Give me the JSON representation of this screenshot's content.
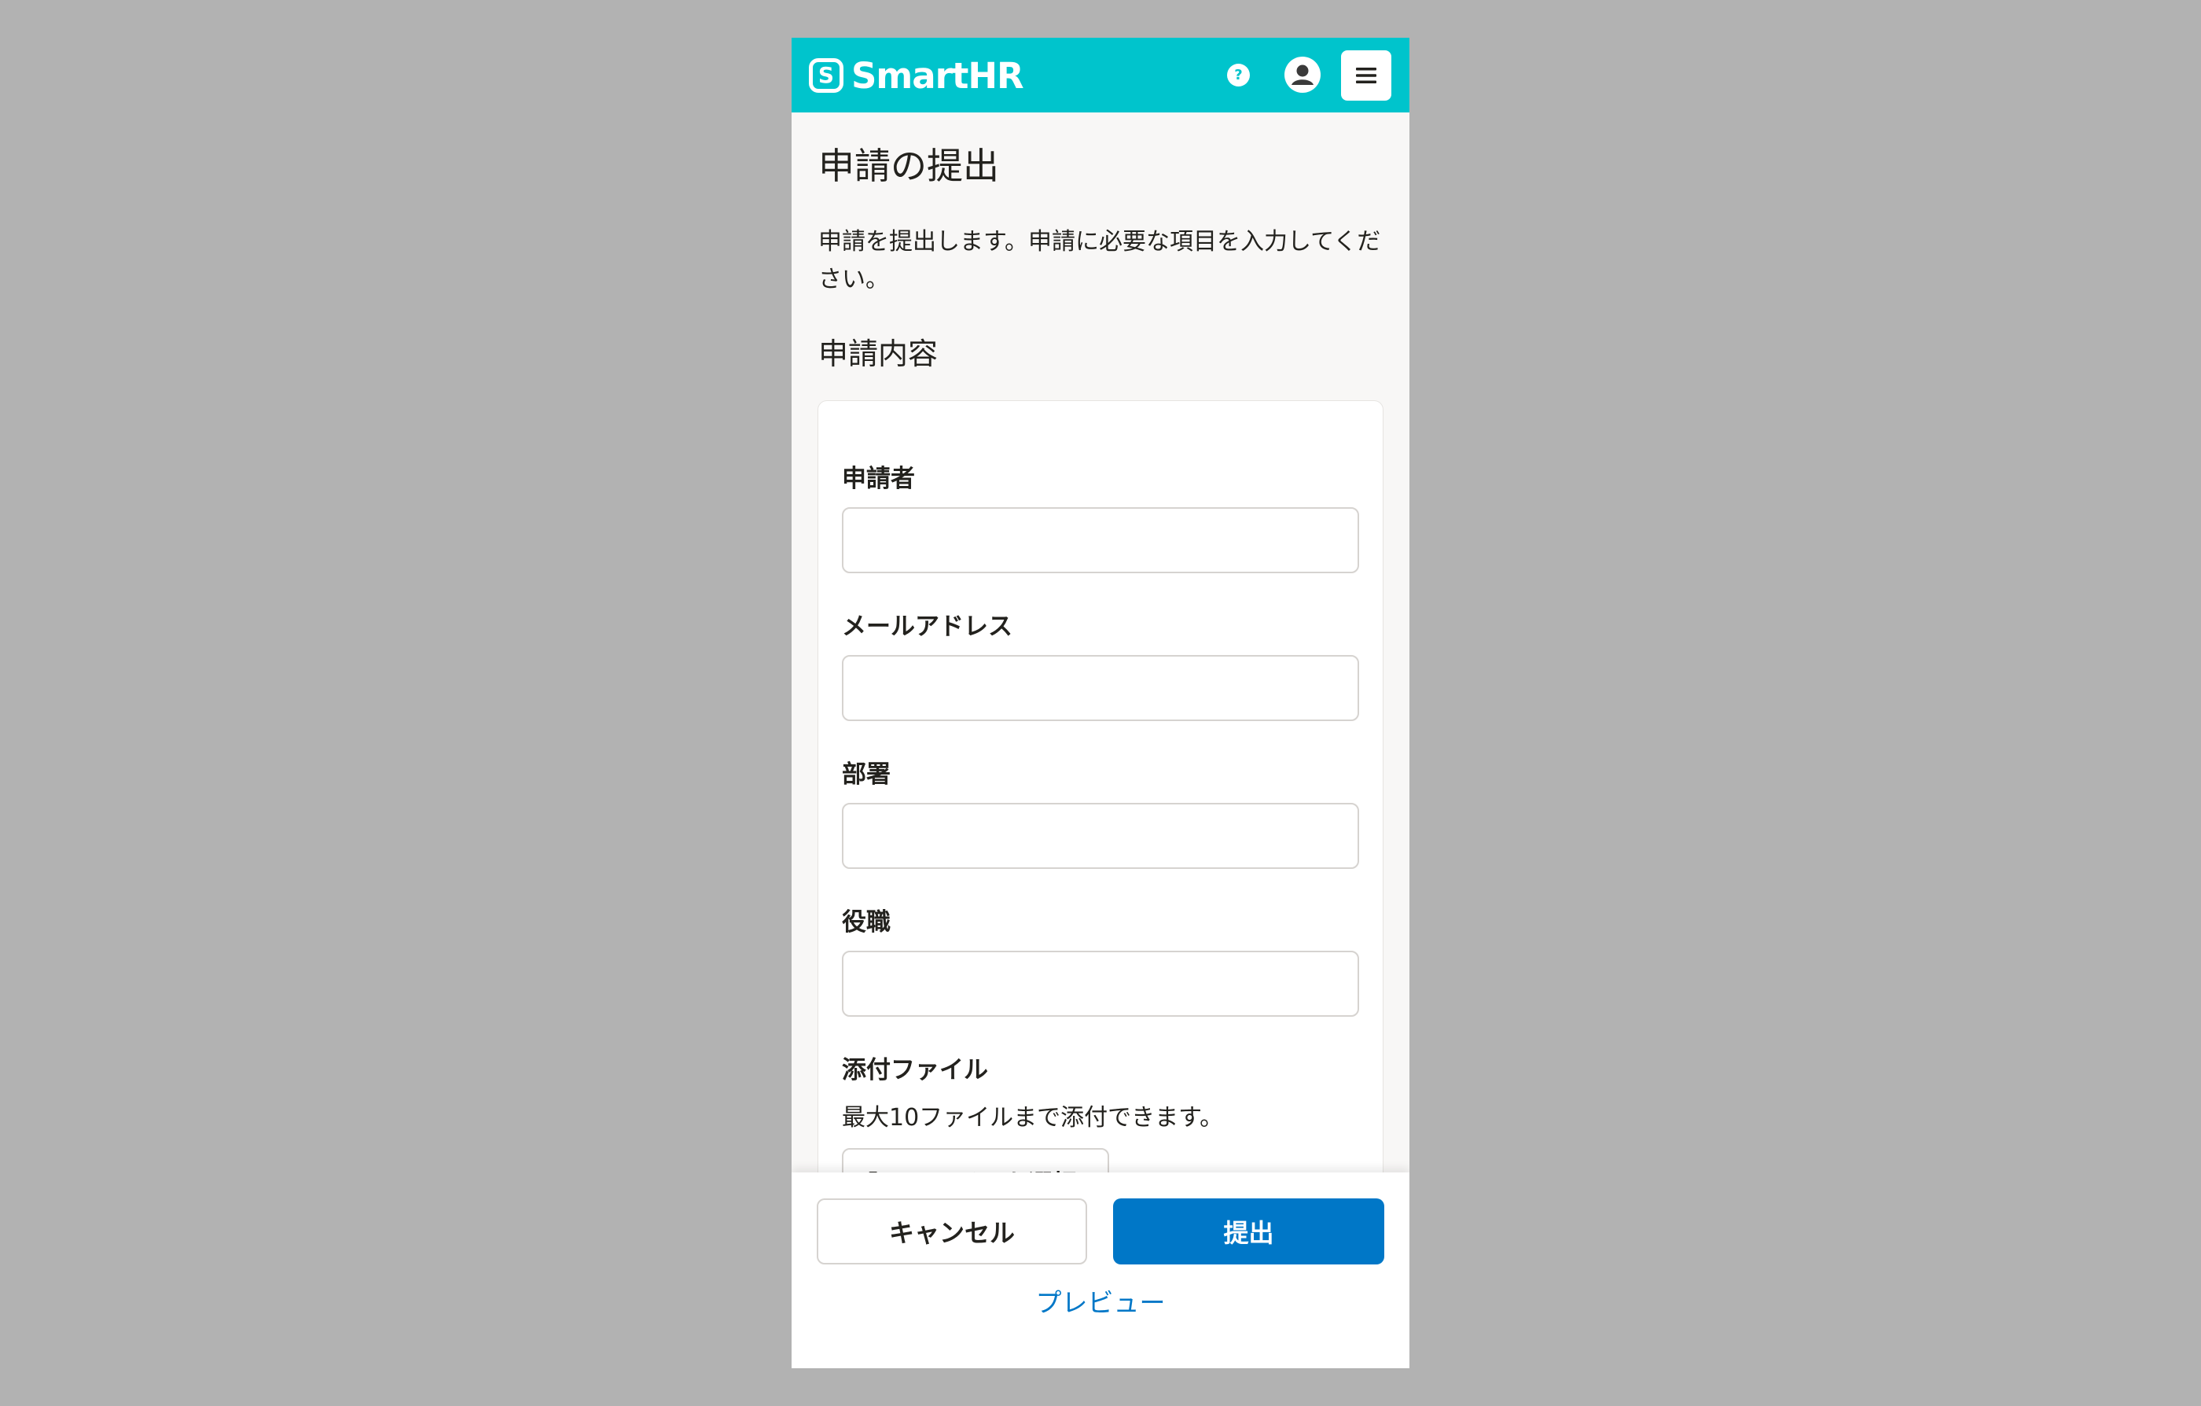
{
  "header": {
    "logo_mark": "S",
    "logo_text": "SmartHR",
    "help_glyph": "?"
  },
  "main": {
    "title": "申請の提出",
    "description": "申請を提出します。申請に必要な項目を入力してください。",
    "section_title": "申請内容"
  },
  "form": {
    "fields": [
      {
        "label": "申請者",
        "value": "",
        "placeholder": ""
      },
      {
        "label": "メールアドレス",
        "value": "",
        "placeholder": ""
      },
      {
        "label": "部署",
        "value": "",
        "placeholder": ""
      },
      {
        "label": "役職",
        "value": "",
        "placeholder": ""
      }
    ],
    "attachment": {
      "label": "添付ファイル",
      "help": "最大10ファイルまで添付できます。",
      "button_label": "ファイルを選択"
    }
  },
  "footer": {
    "cancel_label": "キャンセル",
    "submit_label": "提出",
    "preview_label": "プレビュー"
  },
  "icons": {
    "logo": "smarthr-logo-icon",
    "help": "help-icon",
    "account": "user-avatar-icon",
    "menu": "hamburger-menu-icon",
    "folder": "folder-open-icon"
  },
  "colors": {
    "header_bg": "#00c4cc",
    "primary": "#0077c7",
    "page_bg": "#f8f7f6",
    "backdrop": "#b2b2b2",
    "text": "#23221e"
  }
}
